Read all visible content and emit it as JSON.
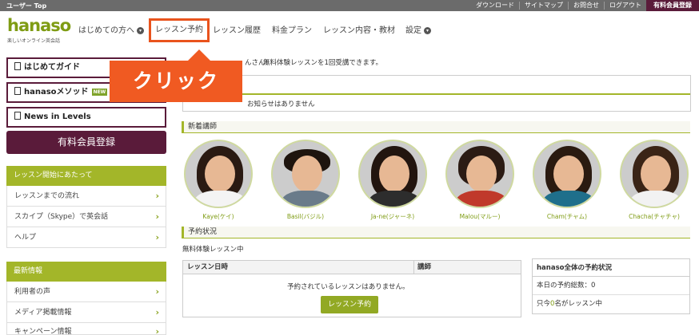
{
  "topbar": {
    "crumb": "ユーザー Top",
    "links": [
      "ダウンロード",
      "サイトマップ",
      "お問合せ",
      "ログアウト"
    ],
    "register": "有料会員登録"
  },
  "logo": {
    "word": "hanaso",
    "tagline": "楽しいオンライン英会話"
  },
  "nav": {
    "items": [
      "はじめての方へ",
      "レッスン予約",
      "レッスン履歴",
      "料金プラン",
      "レッスン内容・教材",
      "設定"
    ]
  },
  "callout": "クリック",
  "sidebar": {
    "buttons": [
      "はじめてガイド",
      "hanasoメソッド",
      "News in Levels"
    ],
    "method_badge": "NEW",
    "register": "有料会員登録",
    "section1": {
      "title": "レッスン開始にあたって",
      "items": [
        "レッスンまでの流れ",
        "スカイプ（Skype）で英会話",
        "ヘルプ"
      ]
    },
    "section2": {
      "title": "最新情報",
      "items": [
        "利用者の声",
        "メディア掲載情報",
        "キャンペーン情報"
      ]
    }
  },
  "main": {
    "welcome": "んさん！",
    "trial_notice": "無料体験レッスンを1回受講できます。",
    "notice_empty": "お知らせはありません",
    "new_teachers_title": "新着講師",
    "teachers": [
      {
        "name": "Kaye(ケイ)",
        "hair": "#2a1a12",
        "shirt": "#f4f4f4"
      },
      {
        "name": "Basil(バジル)",
        "hair": "#1e140e",
        "shirt": "#6a7b8a"
      },
      {
        "name": "Ja-ne(ジャーネ)",
        "hair": "#22150f",
        "shirt": "#2d2d2d"
      },
      {
        "name": "Malou(マルー)",
        "hair": "#2b1b14",
        "shirt": "#c0392b"
      },
      {
        "name": "Cham(チャム)",
        "hair": "#2a1a10",
        "shirt": "#1f6f8b"
      },
      {
        "name": "Chacha(チャチャ)",
        "hair": "#3a2416",
        "shirt": "#f2f2f2"
      }
    ],
    "booking_title": "予約状況",
    "trial_status": "無料体験レッスン中",
    "table": {
      "col_date": "レッスン日時",
      "col_teacher": "講師",
      "empty": "予約されているレッスンはありません。",
      "book_button": "レッスン予約"
    },
    "status": {
      "title": "hanaso全体の予約状況",
      "today_label": "本日の予約総数：0",
      "now_prefix": "只今",
      "now_count": "0",
      "now_suffix": "名がレッスン中"
    }
  },
  "colors": {
    "brand_green": "#a3b629",
    "brand_plum": "#5a1b3a",
    "callout_orange": "#f05a22"
  }
}
